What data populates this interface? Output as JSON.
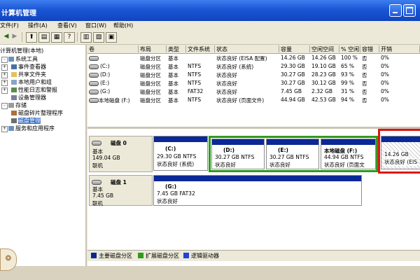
{
  "window": {
    "title": "计算机管理"
  },
  "menu": [
    {
      "label": "文件(F)"
    },
    {
      "label": "操作(A)"
    },
    {
      "label": "查看(V)"
    },
    {
      "label": "窗口(W)"
    },
    {
      "label": "帮助(H)"
    }
  ],
  "tree": [
    {
      "label": "计算机管理(本地)",
      "expander": ""
    },
    {
      "label": "系统工具",
      "expander": "-"
    },
    {
      "label": "事件查看器",
      "expander": "+"
    },
    {
      "label": "共享文件夹",
      "expander": "+"
    },
    {
      "label": "本地用户和组",
      "expander": "+"
    },
    {
      "label": "性能日志和警报",
      "expander": "+"
    },
    {
      "label": "设备管理器",
      "expander": ""
    },
    {
      "label": "存储",
      "expander": "-"
    },
    {
      "label": "磁盘碎片整理程序",
      "expander": ""
    },
    {
      "label": "磁盘管理",
      "expander": ""
    },
    {
      "label": "服务和应用程序",
      "expander": "+"
    }
  ],
  "volume_list": {
    "columns": [
      "卷",
      "布局",
      "类型",
      "文件系统",
      "状态",
      "容量",
      "空闲空间",
      "% 空闲",
      "容错",
      "开销"
    ],
    "rows": [
      {
        "volume": "",
        "layout": "磁盘分区",
        "type": "基本",
        "fs": "",
        "status": "状态良好 (EISA 配置)",
        "capacity": "14.26 GB",
        "free": "14.26 GB",
        "pct": "100 %",
        "ft": "否",
        "overhead": "0%"
      },
      {
        "volume": "(C:)",
        "layout": "磁盘分区",
        "type": "基本",
        "fs": "NTFS",
        "status": "状态良好 (系统)",
        "capacity": "29.30 GB",
        "free": "19.10 GB",
        "pct": "65 %",
        "ft": "否",
        "overhead": "0%"
      },
      {
        "volume": "(D:)",
        "layout": "磁盘分区",
        "type": "基本",
        "fs": "NTFS",
        "status": "状态良好",
        "capacity": "30.27 GB",
        "free": "28.23 GB",
        "pct": "93 %",
        "ft": "否",
        "overhead": "0%"
      },
      {
        "volume": "(E:)",
        "layout": "磁盘分区",
        "type": "基本",
        "fs": "NTFS",
        "status": "状态良好",
        "capacity": "30.27 GB",
        "free": "30.12 GB",
        "pct": "99 %",
        "ft": "否",
        "overhead": "0%"
      },
      {
        "volume": "(G:)",
        "layout": "磁盘分区",
        "type": "基本",
        "fs": "FAT32",
        "status": "状态良好",
        "capacity": "7.45 GB",
        "free": "2.32 GB",
        "pct": "31 %",
        "ft": "否",
        "overhead": "0%"
      },
      {
        "volume": "本地磁盘 (F:)",
        "layout": "磁盘分区",
        "type": "基本",
        "fs": "NTFS",
        "status": "状态良好 (页面文件)",
        "capacity": "44.94 GB",
        "free": "42.53 GB",
        "pct": "94 %",
        "ft": "否",
        "overhead": "0%"
      }
    ]
  },
  "disks": [
    {
      "name": "磁盘 0",
      "type": "基本",
      "size": "149.04 GB",
      "state": "联机",
      "partitions": [
        {
          "name": "(C:)",
          "line1": "29.30 GB NTFS",
          "line2": "状态良好 (系统)"
        },
        {
          "name": "(D:)",
          "line1": "30.27 GB NTFS",
          "line2": "状态良好"
        },
        {
          "name": "(E:)",
          "line1": "30.27 GB NTFS",
          "line2": "状态良好"
        },
        {
          "name": "本地磁盘 (F:)",
          "line1": "44.94 GB NTFS",
          "line2": "状态良好 (页面文"
        },
        {
          "name": "",
          "line1": "14.26 GB",
          "line2": "状态良好 (EIS"
        }
      ]
    },
    {
      "name": "磁盘 1",
      "type": "基本",
      "size": "7.45 GB",
      "state": "联机",
      "partitions": [
        {
          "name": "(G:)",
          "line1": "7.45 GB FAT32",
          "line2": "状态良好"
        }
      ]
    }
  ],
  "legend": [
    {
      "label": "主要磁盘分区",
      "color": "#0a2896"
    },
    {
      "label": "扩展磁盘分区",
      "color": "#2e9a1f"
    },
    {
      "label": "逻辑驱动器",
      "color": "#2040e0"
    }
  ],
  "colors": {
    "highlight_green": "#2e9a1f",
    "highlight_red": "#e01414",
    "partition_bar": "#0a2896",
    "titlebar": "#1b56d3"
  }
}
